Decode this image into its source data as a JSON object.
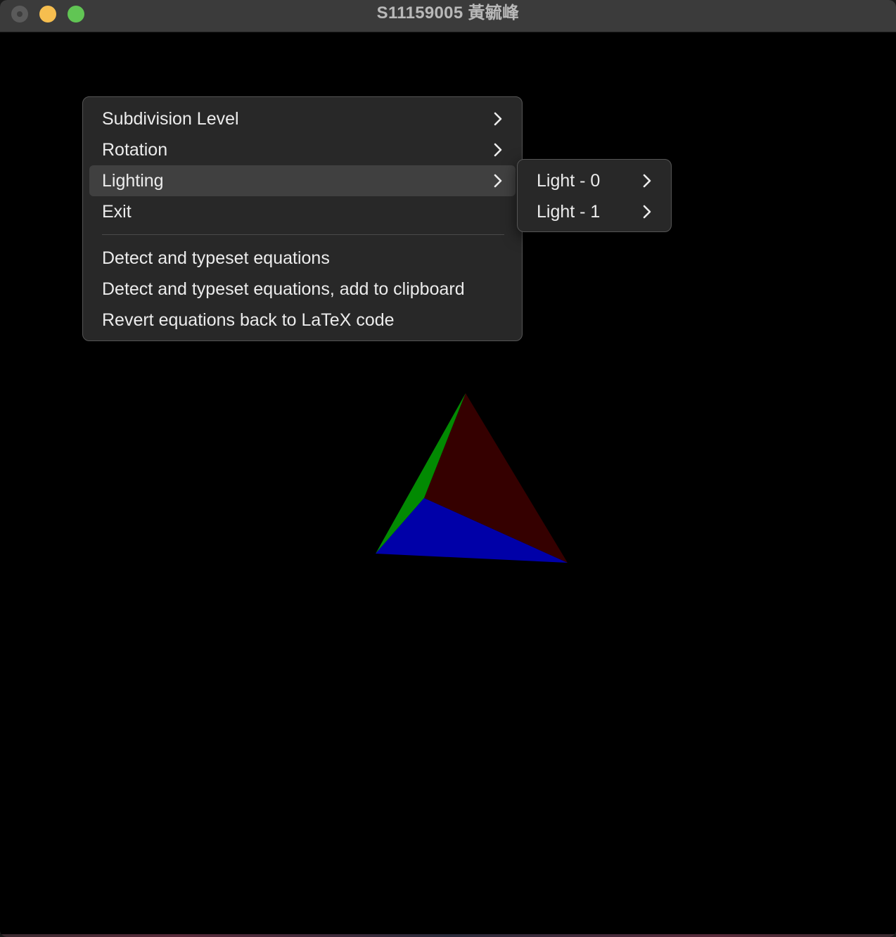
{
  "window": {
    "title": "S11159005 黃毓峰"
  },
  "scene": {
    "object": "tetrahedron",
    "face_colors": {
      "back_face": "#350000",
      "left_face": "#028a02",
      "bottom_face": "#0000a8"
    }
  },
  "context_menu": {
    "items": [
      {
        "label": "Subdivision Level",
        "has_submenu": true,
        "highlighted": false
      },
      {
        "label": "Rotation",
        "has_submenu": true,
        "highlighted": false
      },
      {
        "label": "Lighting",
        "has_submenu": true,
        "highlighted": true
      },
      {
        "label": "Exit",
        "has_submenu": false,
        "highlighted": false
      }
    ],
    "service_items": [
      {
        "label": "Detect and typeset equations"
      },
      {
        "label": "Detect and typeset equations, add to clipboard"
      },
      {
        "label": "Revert equations back to LaTeX code"
      }
    ]
  },
  "lighting_submenu": {
    "items": [
      {
        "label": "Light - 0",
        "has_submenu": true
      },
      {
        "label": "Light - 1",
        "has_submenu": true
      }
    ]
  },
  "colors": {
    "titlebar": "#3b3b3b",
    "menu_bg": "#282828",
    "menu_highlight": "#404040",
    "traffic_close": "#5a5a5a",
    "traffic_minimize": "#f6be4f",
    "traffic_zoom": "#61c554"
  }
}
